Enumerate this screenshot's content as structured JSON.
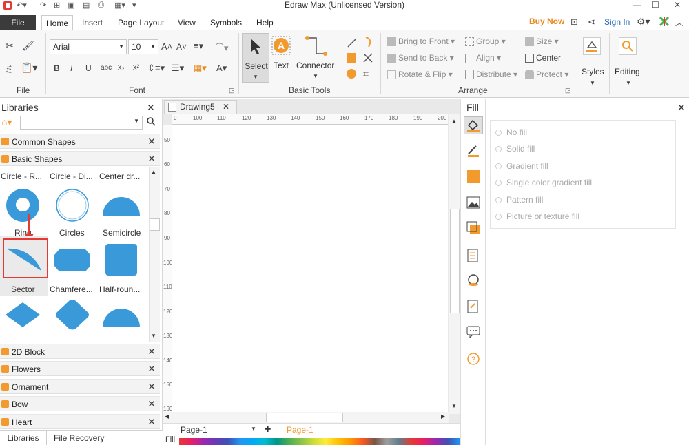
{
  "app_title": "Edraw Max (Unlicensed Version)",
  "menu": {
    "file": "File",
    "tabs": [
      "Home",
      "Insert",
      "Page Layout",
      "View",
      "Symbols",
      "Help"
    ],
    "buy_now": "Buy Now",
    "sign_in": "Sign In"
  },
  "ribbon": {
    "file_group": "File",
    "font_group": "Font",
    "font_name": "Arial",
    "font_size": "10",
    "basic_tools_group": "Basic Tools",
    "select": "Select",
    "text": "Text",
    "connector": "Connector",
    "arrange_group": "Arrange",
    "bring_to_front": "Bring to Front",
    "send_to_back": "Send to Back",
    "rotate_flip": "Rotate & Flip",
    "group": "Group",
    "align": "Align",
    "distribute": "Distribute",
    "size": "Size",
    "center": "Center",
    "protect": "Protect",
    "styles": "Styles",
    "editing": "Editing"
  },
  "libraries": {
    "title": "Libraries",
    "common_shapes": "Common Shapes",
    "basic_shapes": "Basic Shapes",
    "shapes_row1": [
      "Circle - R...",
      "Circle - Di...",
      "Center dr..."
    ],
    "shapes_row2": [
      "Ring",
      "Circles",
      "Semicircle"
    ],
    "shapes_row3": [
      "Sector",
      "Chamfere...",
      "Half-roun..."
    ],
    "other_libs": [
      "2D Block",
      "Flowers",
      "Ornament",
      "Bow",
      "Heart"
    ],
    "bottom_tabs": [
      "Libraries",
      "File Recovery"
    ]
  },
  "canvas": {
    "doc_tab": "Drawing5",
    "hruler": [
      "100",
      "110",
      "120",
      "130",
      "140",
      "150",
      "160",
      "170",
      "180",
      "190",
      "200"
    ],
    "vruler": [
      "50",
      "60",
      "70",
      "80",
      "90",
      "100",
      "110",
      "120",
      "130",
      "140",
      "150",
      "160"
    ],
    "page_select": "Page-1",
    "page_active": "Page-1",
    "fill_label": "Fill"
  },
  "fill": {
    "title": "Fill",
    "options": [
      "No fill",
      "Solid fill",
      "Gradient fill",
      "Single color gradient fill",
      "Pattern fill",
      "Picture or texture fill"
    ]
  },
  "colors": {
    "accent": "#3a9ad9",
    "highlight": "#e53935",
    "orange": "#f29a2e"
  }
}
